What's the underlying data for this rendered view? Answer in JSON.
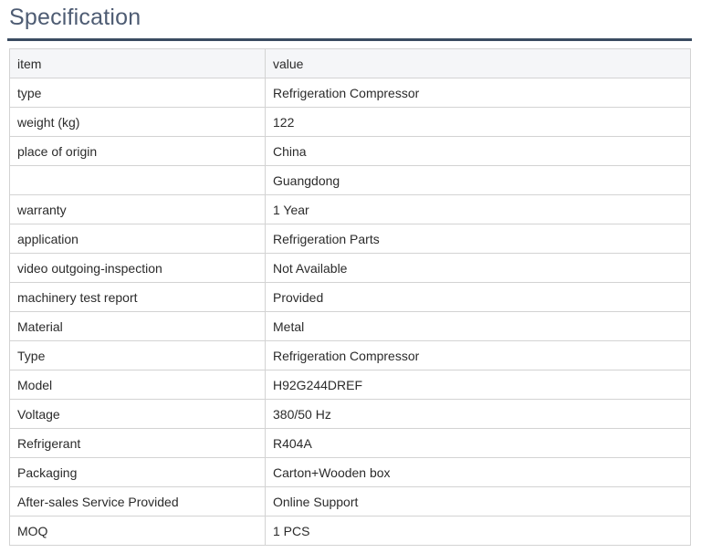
{
  "page": {
    "title": "Specification"
  },
  "table": {
    "headers": [
      "item",
      "value"
    ],
    "rows": [
      {
        "item": "type",
        "value": "Refrigeration Compressor"
      },
      {
        "item": "weight (kg)",
        "value": "122"
      },
      {
        "item": "place of origin",
        "value": "China"
      },
      {
        "item": "",
        "value": "Guangdong"
      },
      {
        "item": "warranty",
        "value": "1 Year"
      },
      {
        "item": "application",
        "value": "Refrigeration Parts"
      },
      {
        "item": "video outgoing-inspection",
        "value": "Not Available"
      },
      {
        "item": "machinery test report",
        "value": "Provided"
      },
      {
        "item": "Material",
        "value": "Metal"
      },
      {
        "item": "Type",
        "value": "Refrigeration Compressor"
      },
      {
        "item": "Model",
        "value": "H92G244DREF"
      },
      {
        "item": "Voltage",
        "value": "380/50 Hz"
      },
      {
        "item": "Refrigerant",
        "value": "R404A"
      },
      {
        "item": "Packaging",
        "value": "Carton+Wooden box"
      },
      {
        "item": "After-sales Service Provided",
        "value": "Online Support"
      },
      {
        "item": "MOQ",
        "value": "1 PCS"
      }
    ]
  },
  "colors": {
    "title_text": "#4e5c73",
    "title_rule": "#3a4b61",
    "header_background": "#f5f6f8",
    "table_border": "#d3d3d3",
    "cell_text": "#2b2b2b"
  }
}
